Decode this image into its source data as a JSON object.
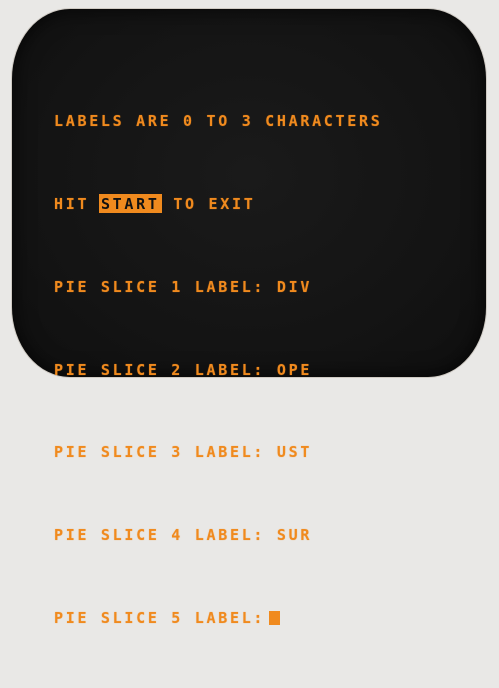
{
  "colors": {
    "phosphor": "#f08a1e",
    "screen_bg": "#141414",
    "bezel": "#e9e8e6"
  },
  "terminal": {
    "line1": "LABELS ARE 0 TO 3 CHARACTERS",
    "line2_prefix": "HIT",
    "line2_key": "START",
    "line2_suffix": "TO EXIT",
    "prompts": [
      {
        "prompt": "PIE SLICE 1 LABEL:",
        "value": "DIV"
      },
      {
        "prompt": "PIE SLICE 2 LABEL:",
        "value": "OPE"
      },
      {
        "prompt": "PIE SLICE 3 LABEL:",
        "value": "UST"
      },
      {
        "prompt": "PIE SLICE 4 LABEL:",
        "value": "SUR"
      },
      {
        "prompt": "PIE SLICE 5 LABEL:",
        "value": ""
      }
    ]
  }
}
